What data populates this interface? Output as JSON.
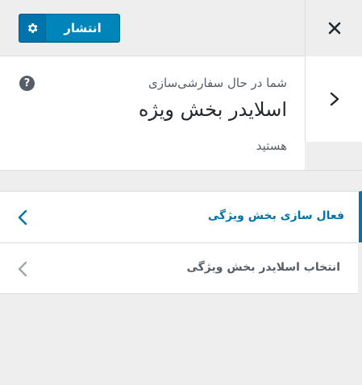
{
  "header": {
    "publish_label": "انتشار",
    "settings_icon": "gear-icon",
    "close_icon": "close-icon"
  },
  "info": {
    "line1": "شما در حال سفارشی‌سازی",
    "title": "اسلایدر بخش ویژه",
    "line3": "هستید",
    "help_label": "?"
  },
  "sections": [
    {
      "label": "فعال سازی بخش ویژگی",
      "active": true
    },
    {
      "label": "انتخاب اسلایدر بخش ویژگی",
      "active": false
    }
  ],
  "colors": {
    "accent": "#0073aa",
    "publish_bg": "#0085ba",
    "panel_bg": "#eeeeee",
    "text": "#555d66"
  }
}
